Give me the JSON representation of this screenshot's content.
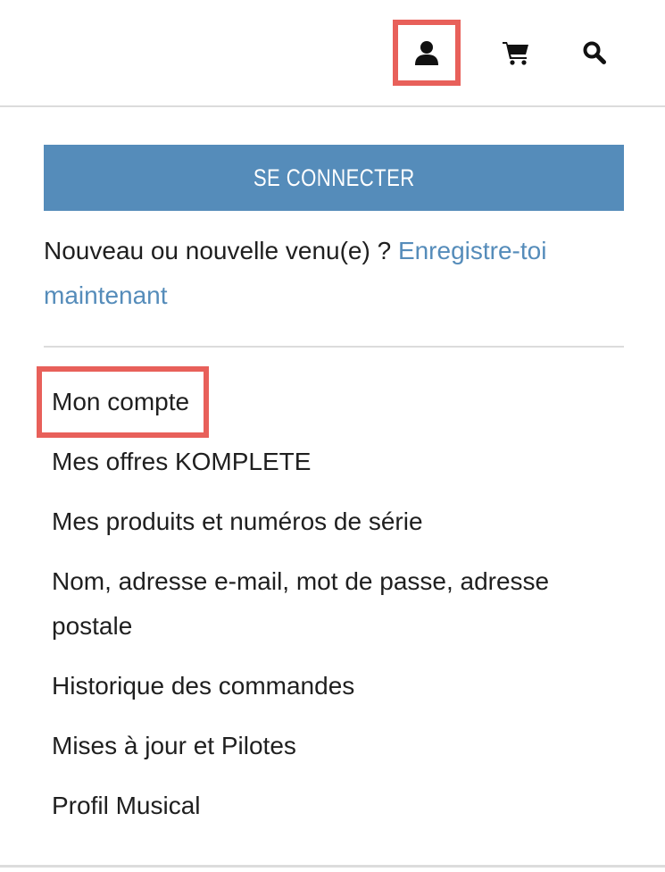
{
  "header": {
    "icons": [
      {
        "name": "user-icon"
      },
      {
        "name": "cart-icon"
      },
      {
        "name": "search-icon"
      }
    ]
  },
  "colors": {
    "accent": "#558cba",
    "highlight": "#e8605a",
    "divider": "#dcdcdc",
    "text": "#1f1f1f"
  },
  "login": {
    "button_label": "SE CONNECTER"
  },
  "register": {
    "prompt": "Nouveau ou nouvelle venu(e) ? ",
    "link": "Enregistre-toi maintenant"
  },
  "menu": {
    "items": [
      {
        "label": "Mon compte"
      },
      {
        "label": "Mes offres KOMPLETE"
      },
      {
        "label": "Mes produits et numéros de série"
      },
      {
        "label": "Nom, adresse e-mail, mot de passe, adresse postale"
      },
      {
        "label": "Historique des commandes"
      },
      {
        "label": "Mises à jour et Pilotes"
      },
      {
        "label": "Profil Musical"
      }
    ]
  }
}
